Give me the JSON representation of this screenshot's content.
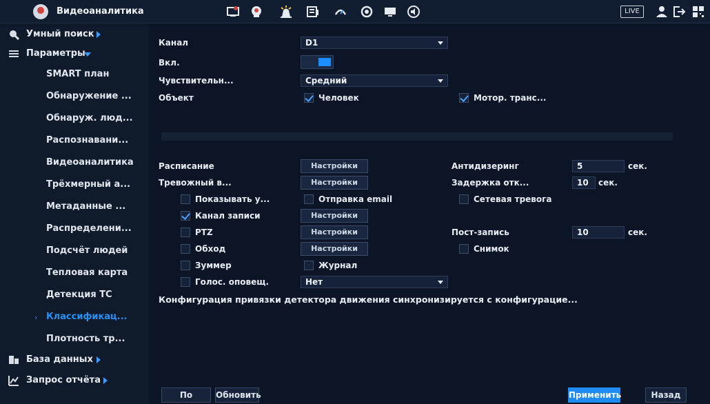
{
  "header": {
    "title": "Видеоаналитика",
    "live_label": "LIVE"
  },
  "sidebar": {
    "smart_search": "Умный поиск",
    "parameters": "Параметры",
    "items": [
      "SMART план",
      "Обнаружение ...",
      "Обнаруж. люд...",
      "Распознавани...",
      "Видеоаналитика",
      "Трёхмерный а...",
      "Метаданные ...",
      "Распределени...",
      "Подсчёт людей",
      "Тепловая карта",
      "Детекция ТС",
      "Классификац...",
      "Плотность тр..."
    ],
    "active_item": "Классификац...",
    "database": "База данных",
    "report": "Запрос отчёта"
  },
  "form": {
    "channel_label": "Канал",
    "channel_value": "D1",
    "enable_label": "Вкл.",
    "enable_on": true,
    "sensitivity_label": "Чувствительн...",
    "sensitivity_value": "Средний",
    "object_label": "Объект",
    "object_person": "Человек",
    "object_vehicle": "Мотор. транс..."
  },
  "actions": {
    "schedule_label": "Расписание",
    "settings_label": "Настройки",
    "alarm_in_label": "Тревожный в...",
    "antidither_label": "Антидизеринг",
    "antidither_value": "5",
    "delay_label": "Задержка отк...",
    "delay_value": "10",
    "sec_unit": "сек.",
    "show_label": "Показывать у...",
    "send_email_label": "Отправка email",
    "network_alarm_label": "Сетевая тревога",
    "record_channel_label": "Канал записи",
    "ptz_label": "PTZ",
    "post_record_label": "Пост-запись",
    "post_record_value": "10",
    "tour_label": "Обход",
    "snapshot_label": "Снимок",
    "buzzer_label": "Зуммер",
    "log_label": "Журнал",
    "voice_label": "Голос. оповещ.",
    "voice_value": "Нет",
    "note": "Конфигурация привязки детектора движения синхронизируется с конфигурацие..."
  },
  "footer": {
    "default_label": "По умолч...",
    "refresh_label": "Обновить",
    "apply_label": "Применить",
    "back_label": "Назад"
  },
  "colors": {
    "accent": "#1f8cf5",
    "background": "#0b1526",
    "sidebar": "#0f1a2b"
  },
  "icons": {
    "top": [
      "display-settings-icon",
      "ai-face-icon",
      "alarm-icon",
      "storage-icon",
      "network-icon",
      "camera-icon",
      "monitor-icon",
      "sound-icon",
      "user-icon",
      "logout-icon",
      "qr-icon"
    ]
  }
}
